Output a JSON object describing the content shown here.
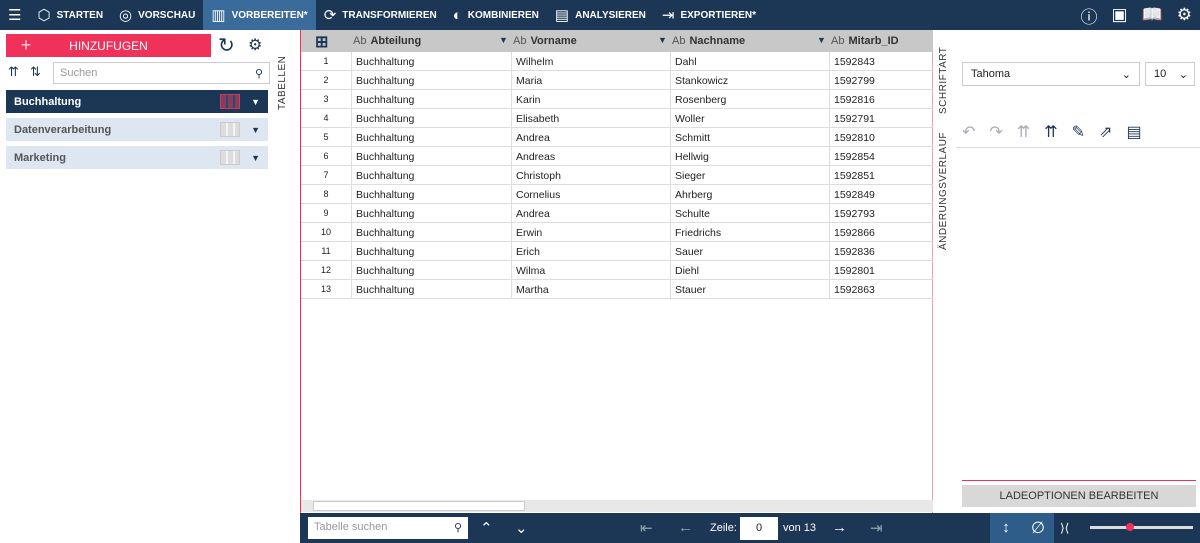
{
  "nav": {
    "items": [
      {
        "label": "STARTEN",
        "icon": "cube-icon"
      },
      {
        "label": "VORSCHAU",
        "icon": "eye-icon"
      },
      {
        "label": "VORBEREITEN*",
        "icon": "columns-icon",
        "active": true
      },
      {
        "label": "TRANSFORMIEREN",
        "icon": "transform-icon"
      },
      {
        "label": "KOMBINIEREN",
        "icon": "combine-icon"
      },
      {
        "label": "ANALYSIEREN",
        "icon": "clipboard-icon"
      },
      {
        "label": "EXPORTIEREN*",
        "icon": "export-icon"
      }
    ]
  },
  "left": {
    "add_label": "HINZUFUGEN",
    "search_placeholder": "Suchen",
    "strip_label": "TABELLEN",
    "groups": [
      "Buchhaltung",
      "Datenverarbeitung",
      "Marketing"
    ]
  },
  "grid": {
    "columns": [
      {
        "type": "Ab",
        "name": "Abteilung"
      },
      {
        "type": "Ab",
        "name": "Vorname"
      },
      {
        "type": "Ab",
        "name": "Nachname"
      },
      {
        "type": "Ab",
        "name": "Mitarb_ID"
      }
    ],
    "rows": [
      [
        "1",
        "Buchhaltung",
        "Wilhelm",
        "Dahl",
        "1592843"
      ],
      [
        "2",
        "Buchhaltung",
        "Maria",
        "Stankowicz",
        "1592799"
      ],
      [
        "3",
        "Buchhaltung",
        "Karin",
        "Rosenberg",
        "1592816"
      ],
      [
        "4",
        "Buchhaltung",
        "Elisabeth",
        "Woller",
        "1592791"
      ],
      [
        "5",
        "Buchhaltung",
        "Andrea",
        "Schmitt",
        "1592810"
      ],
      [
        "6",
        "Buchhaltung",
        "Andreas",
        "Hellwig",
        "1592854"
      ],
      [
        "7",
        "Buchhaltung",
        "Christoph",
        "Sieger",
        "1592851"
      ],
      [
        "8",
        "Buchhaltung",
        "Cornelius",
        "Ahrberg",
        "1592849"
      ],
      [
        "9",
        "Buchhaltung",
        "Andrea",
        "Schulte",
        "1592793"
      ],
      [
        "10",
        "Buchhaltung",
        "Erwin",
        "Friedrichs",
        "1592866"
      ],
      [
        "11",
        "Buchhaltung",
        "Erich",
        "Sauer",
        "1592836"
      ],
      [
        "12",
        "Buchhaltung",
        "Wilma",
        "Diehl",
        "1592801"
      ],
      [
        "13",
        "Buchhaltung",
        "Martha",
        "Stauer",
        "1592863"
      ]
    ]
  },
  "right": {
    "strip_font": "SCHRIFTART",
    "strip_history": "ÄNDERUNGSVERLAUF",
    "font": "Tahoma",
    "size": "10",
    "load_button": "LADEOPTIONEN BEARBEITEN"
  },
  "bottom": {
    "search_placeholder": "Tabelle suchen",
    "row_label": "Zeile:",
    "row_value": "0",
    "of_label": "von 13",
    "zoom_percent": 25
  }
}
